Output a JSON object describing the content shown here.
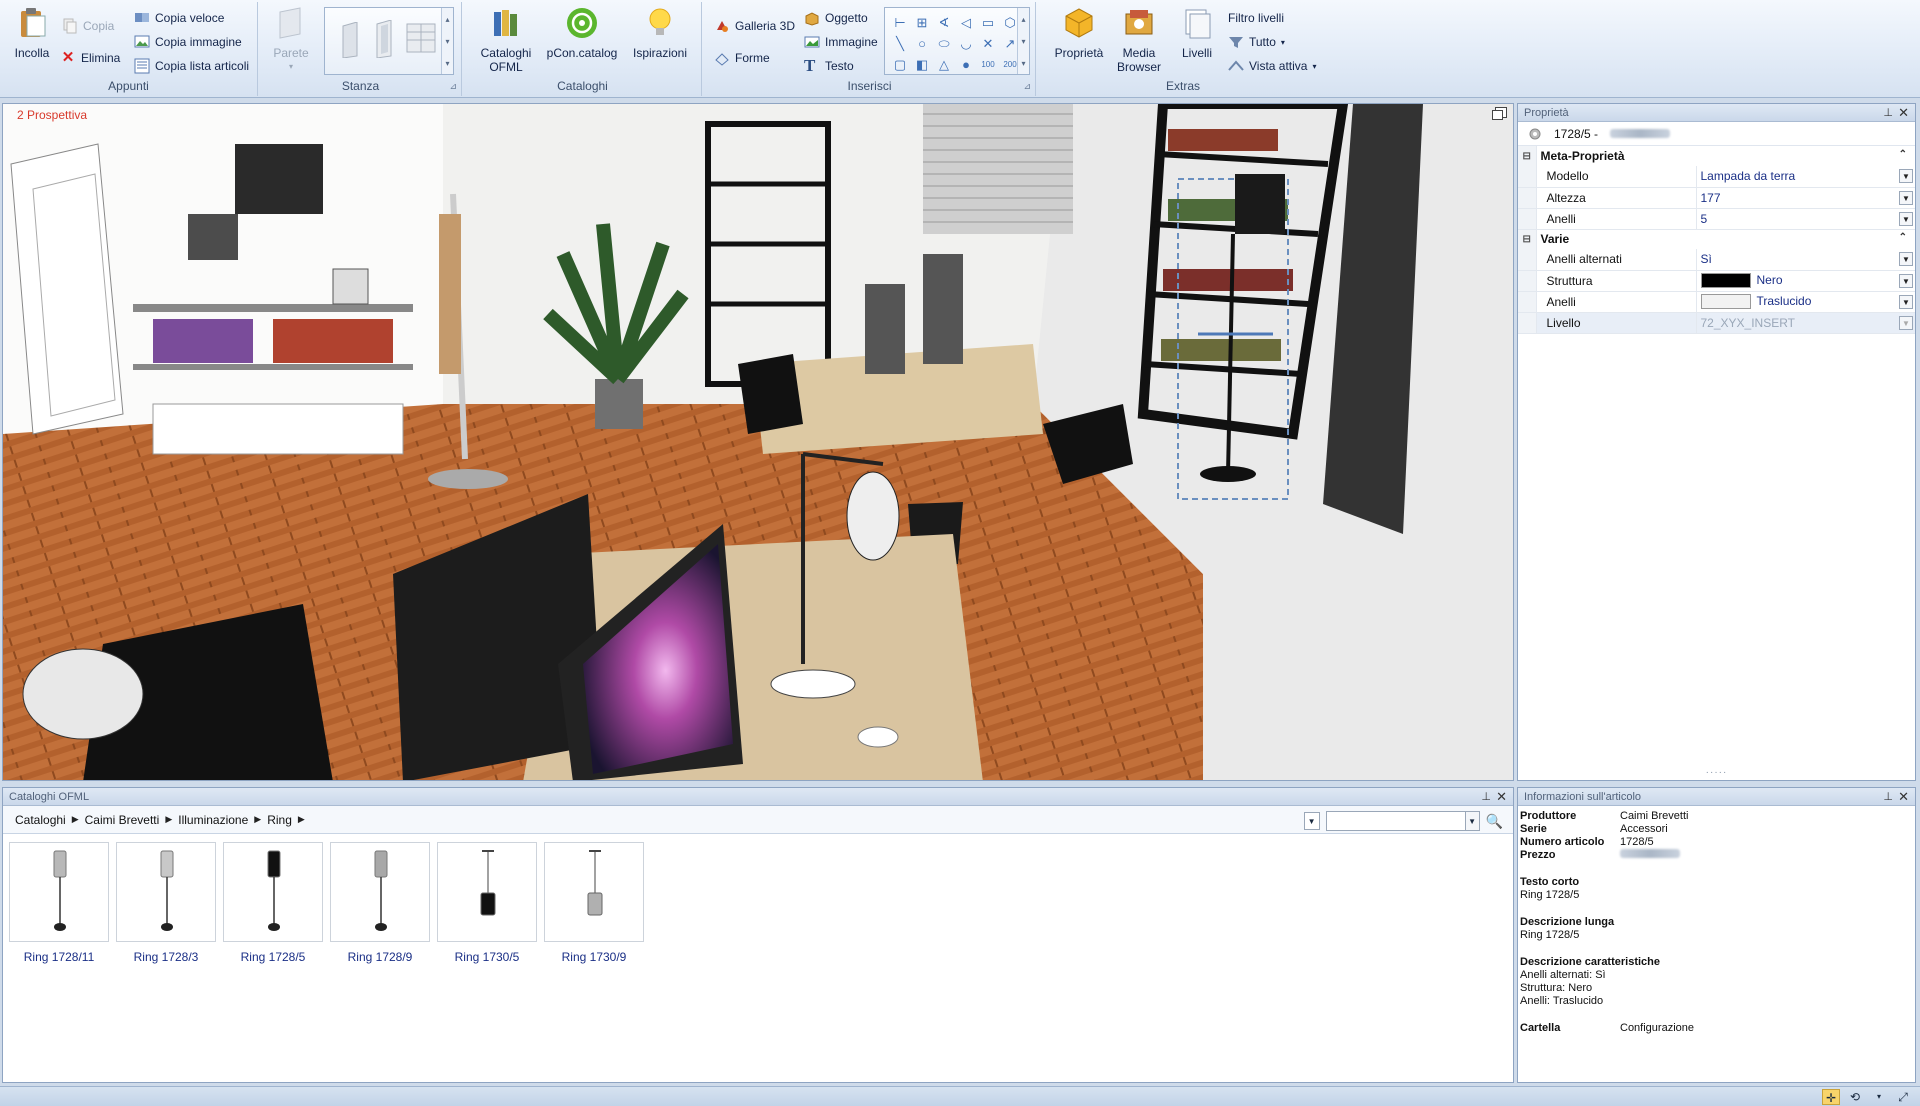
{
  "ribbon": {
    "appunti": {
      "label": "Appunti",
      "incolla": "Incolla",
      "copia": "Copia",
      "elimina": "Elimina",
      "copia_veloce": "Copia veloce",
      "copia_immagine": "Copia immagine",
      "copia_lista": "Copia lista articoli"
    },
    "stanza": {
      "label": "Stanza",
      "parete": "Parete"
    },
    "cataloghi": {
      "label": "Cataloghi",
      "ofml_1": "Cataloghi",
      "ofml_2": "OFML",
      "pcon": "pCon.catalog",
      "ispirazioni": "Ispirazioni"
    },
    "inserisci": {
      "label": "Inserisci",
      "galleria": "Galleria 3D",
      "forme": "Forme",
      "oggetto": "Oggetto",
      "immagine": "Immagine",
      "testo": "Testo"
    },
    "extras": {
      "label": "Extras",
      "proprieta": "Proprietà",
      "media_1": "Media",
      "media_2": "Browser",
      "livelli": "Livelli",
      "filtro": "Filtro livelli",
      "tutto": "Tutto",
      "vista": "Vista attiva"
    },
    "colors": {
      "ribbon_bg": "#e2ebf7",
      "accent": "#1a2f86"
    }
  },
  "viewport": {
    "label": "2 Prospettiva"
  },
  "properties": {
    "title": "Proprietà",
    "object_id": "1728/5 -",
    "categories": [
      {
        "name": "Meta-Proprietà",
        "rows": [
          {
            "name": "Modello",
            "value": "Lampada da terra"
          },
          {
            "name": "Altezza",
            "value": "177"
          },
          {
            "name": "Anelli",
            "value": "5"
          }
        ]
      },
      {
        "name": "Varie",
        "rows": [
          {
            "name": "Anelli alternati",
            "value": "Sì"
          },
          {
            "name": "Struttura",
            "value": "Nero",
            "swatch": "#000000"
          },
          {
            "name": "Anelli",
            "value": "Traslucido",
            "swatch": "#f2f2f2"
          }
        ]
      }
    ],
    "livello": {
      "name": "Livello",
      "value": "72_XYX_INSERT"
    }
  },
  "catalog": {
    "title": "Cataloghi OFML",
    "breadcrumb": [
      "Cataloghi",
      "Caimi Brevetti",
      "Illuminazione",
      "Ring"
    ],
    "search_placeholder": "",
    "items": [
      {
        "label": "Ring 1728/11",
        "type": "floor",
        "shade": "#b8b8b8"
      },
      {
        "label": "Ring 1728/3",
        "type": "floor",
        "shade": "#c8c8c8"
      },
      {
        "label": "Ring 1728/5",
        "type": "floor",
        "shade": "#111111"
      },
      {
        "label": "Ring 1728/9",
        "type": "floor",
        "shade": "#a8a8a8"
      },
      {
        "label": "Ring 1730/5",
        "type": "pendant",
        "shade": "#111111"
      },
      {
        "label": "Ring 1730/9",
        "type": "pendant",
        "shade": "#b0b0b0"
      }
    ]
  },
  "info": {
    "title": "Informazioni sull'articolo",
    "produttore_k": "Produttore",
    "produttore_v": "Caimi Brevetti",
    "serie_k": "Serie",
    "serie_v": "Accessori",
    "numero_k": "Numero articolo",
    "numero_v": "1728/5",
    "prezzo_k": "Prezzo",
    "testo_corto_h": "Testo corto",
    "testo_corto_v": "Ring 1728/5",
    "desc_lunga_h": "Descrizione lunga",
    "desc_lunga_v": "Ring 1728/5",
    "desc_car_h": "Descrizione caratteristiche",
    "desc_car_lines": [
      "Anelli alternati: Sì",
      "Struttura: Nero",
      "Anelli: Traslucido"
    ],
    "cartella_k": "Cartella",
    "cartella_v": "Configurazione"
  }
}
